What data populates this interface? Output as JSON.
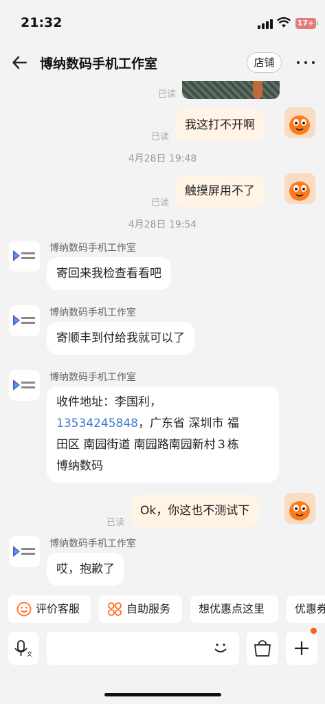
{
  "status_bar": {
    "time": "21:32",
    "battery": "17+"
  },
  "header": {
    "title": "博纳数码手机工作室",
    "store_label": "店铺"
  },
  "messages": {
    "read_label": "已读",
    "m1": "我这打不开啊",
    "t1": "4月28日 19:48",
    "m2": "触摸屏用不了",
    "t2": "4月28日 19:54",
    "shop_name": "博纳数码手机工作室",
    "s1": "寄回来我检查看看吧",
    "s2": "寄顺丰到付给我就可以了",
    "s3_line1": "收件地址：李国利，",
    "s3_phone": "13534245848",
    "s3_line2_rest": "，广东省 深圳市 福",
    "s3_line3": "田区 南园街道 南园路南园新村３栋",
    "s3_line4": "博纳数码",
    "m3": "Ok，你这也不测试下",
    "s4": "哎，抱歉了"
  },
  "quick_actions": [
    "评价客服",
    "自助服务",
    "想优惠点这里",
    "优惠券"
  ],
  "colors": {
    "accent": "#ff5a1f",
    "link": "#3d78d6",
    "my_bubble": "#fff4e6"
  }
}
